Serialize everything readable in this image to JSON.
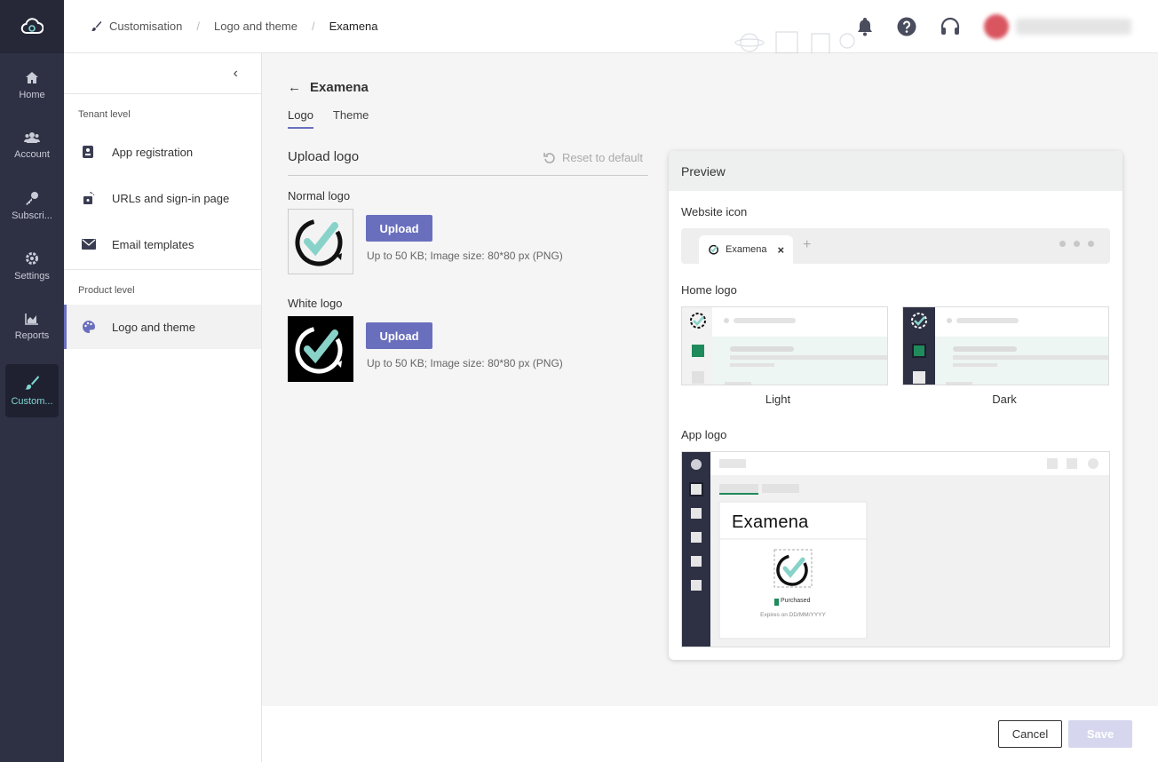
{
  "app_rail": {
    "items": [
      {
        "label": "Home",
        "icon": "home-icon"
      },
      {
        "label": "Account",
        "icon": "users-icon"
      },
      {
        "label": "Subscri...",
        "icon": "key-icon"
      },
      {
        "label": "Settings",
        "icon": "gear-icon"
      },
      {
        "label": "Reports",
        "icon": "chart-icon"
      },
      {
        "label": "Custom...",
        "icon": "brush-icon",
        "active": true
      }
    ]
  },
  "breadcrumb": [
    "Customisation",
    "Logo and theme",
    "Examena"
  ],
  "sidebar": {
    "collapse_icon": "chevron-left-icon",
    "tenant_section": "Tenant level",
    "tenant_items": [
      {
        "label": "App registration",
        "icon": "app-registration-icon"
      },
      {
        "label": "URLs and sign-in page",
        "icon": "sign-in-icon"
      },
      {
        "label": "Email templates",
        "icon": "envelope-icon"
      }
    ],
    "product_section": "Product level",
    "product_items": [
      {
        "label": "Logo and theme",
        "icon": "palette-icon",
        "active": true
      }
    ]
  },
  "page": {
    "title": "Examena",
    "tabs": [
      "Logo",
      "Theme"
    ],
    "active_tab": "Logo",
    "upload_heading": "Upload logo",
    "reset_label": "Reset to default",
    "normal_logo": {
      "label": "Normal logo",
      "button": "Upload",
      "hint": "Up to 50 KB; Image size: 80*80 px (PNG)"
    },
    "white_logo": {
      "label": "White logo",
      "button": "Upload",
      "hint": "Up to 50 KB; Image size: 80*80 px (PNG)"
    }
  },
  "preview": {
    "title": "Preview",
    "website_icon_label": "Website icon",
    "browser_tab_label": "Examena",
    "home_logo_label": "Home logo",
    "light_label": "Light",
    "dark_label": "Dark",
    "app_logo_label": "App logo",
    "app_card_title": "Examena",
    "app_card_badge": "Purchased",
    "app_card_expiry": "Expires on DD/MM/YYYY"
  },
  "footer": {
    "cancel": "Cancel",
    "save": "Save"
  },
  "colors": {
    "accent": "#6a6fbd",
    "rail": "#2e3144",
    "teal": "#7fd6d0",
    "green": "#1f8a5b"
  }
}
